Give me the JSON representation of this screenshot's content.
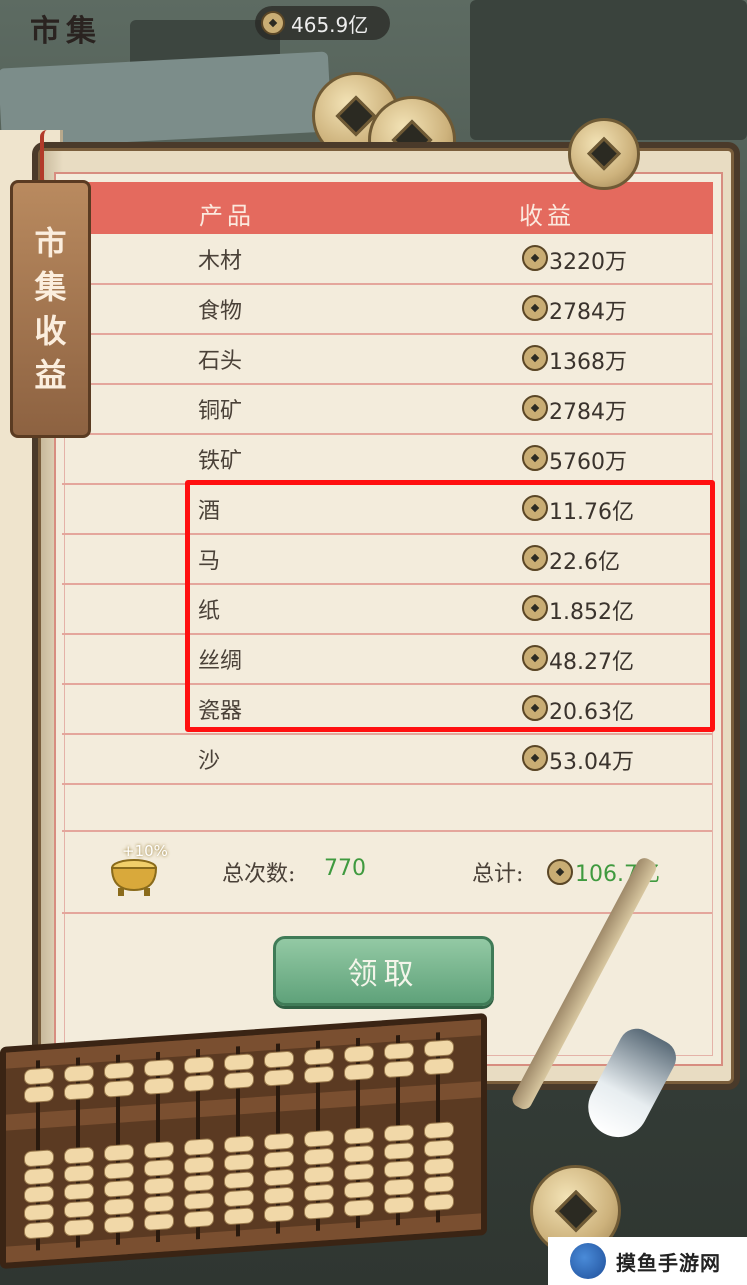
{
  "top_bar": {
    "title": "市集",
    "currency": "465.9亿"
  },
  "tag": {
    "chars": [
      "市",
      "集",
      "收",
      "益"
    ]
  },
  "table": {
    "headers": {
      "product": "产品",
      "income": "收益"
    },
    "rows": [
      {
        "name": "木材",
        "value": "3220万"
      },
      {
        "name": "食物",
        "value": "2784万"
      },
      {
        "name": "石头",
        "value": "1368万"
      },
      {
        "name": "铜矿",
        "value": "2784万"
      },
      {
        "name": "铁矿",
        "value": "5760万"
      },
      {
        "name": "酒",
        "value": "11.76亿"
      },
      {
        "name": "马",
        "value": "22.6亿"
      },
      {
        "name": "纸",
        "value": "1.852亿"
      },
      {
        "name": "丝绸",
        "value": "48.27亿"
      },
      {
        "name": "瓷器",
        "value": "20.63亿"
      },
      {
        "name": "沙",
        "value": "53.04万"
      }
    ]
  },
  "summary": {
    "bonus": "+10%",
    "count_label": "总次数:",
    "count": "770",
    "total_label": "总计:",
    "total": "106.7亿"
  },
  "claim_button": "领取",
  "watermark": "摸鱼手游网",
  "colors": {
    "header": "#e46a5e",
    "highlight": "#ff1010",
    "green_value": "#3f9a3f",
    "button": "#6fb085"
  }
}
